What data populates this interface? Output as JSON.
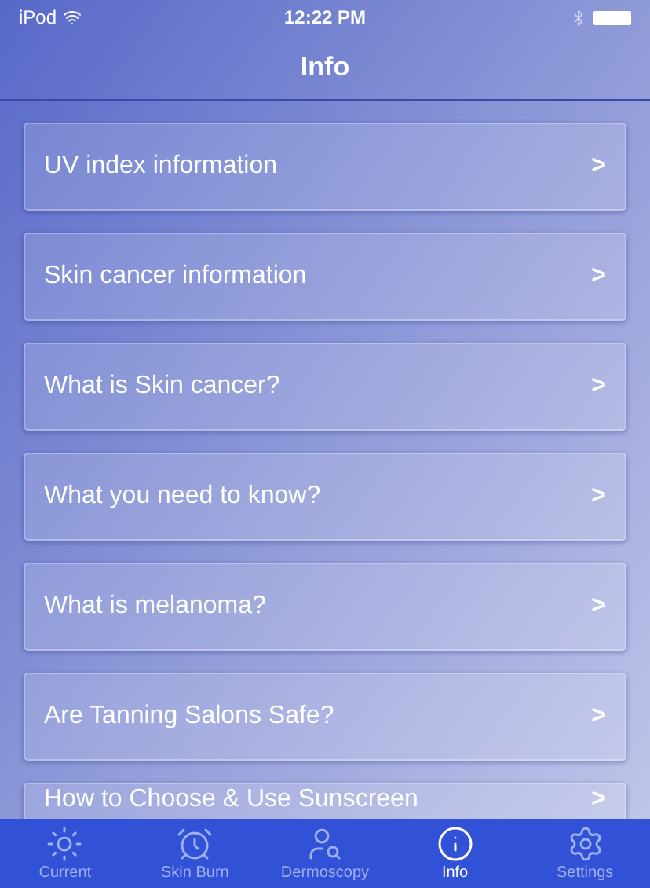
{
  "status_bar": {
    "carrier": "iPod",
    "time": "12:22 PM"
  },
  "nav_bar": {
    "title": "Info"
  },
  "items": [
    {
      "label": "UV index information",
      "chevron": ">"
    },
    {
      "label": "Skin cancer information",
      "chevron": ">"
    },
    {
      "label": "What is Skin cancer?",
      "chevron": ">"
    },
    {
      "label": "What you need to know?",
      "chevron": ">"
    },
    {
      "label": "What is melanoma?",
      "chevron": ">"
    },
    {
      "label": "Are Tanning Salons Safe?",
      "chevron": ">"
    },
    {
      "label": "How to Choose & Use Sunscreen",
      "chevron": ">"
    }
  ],
  "tab_bar": [
    {
      "label": "Current",
      "kind": "sun",
      "selected": false
    },
    {
      "label": "Skin Burn",
      "kind": "clock",
      "selected": false
    },
    {
      "label": "Dermoscopy",
      "kind": "person",
      "selected": false
    },
    {
      "label": "Info",
      "kind": "info",
      "selected": true
    },
    {
      "label": "Settings",
      "kind": "gear",
      "selected": false
    }
  ]
}
